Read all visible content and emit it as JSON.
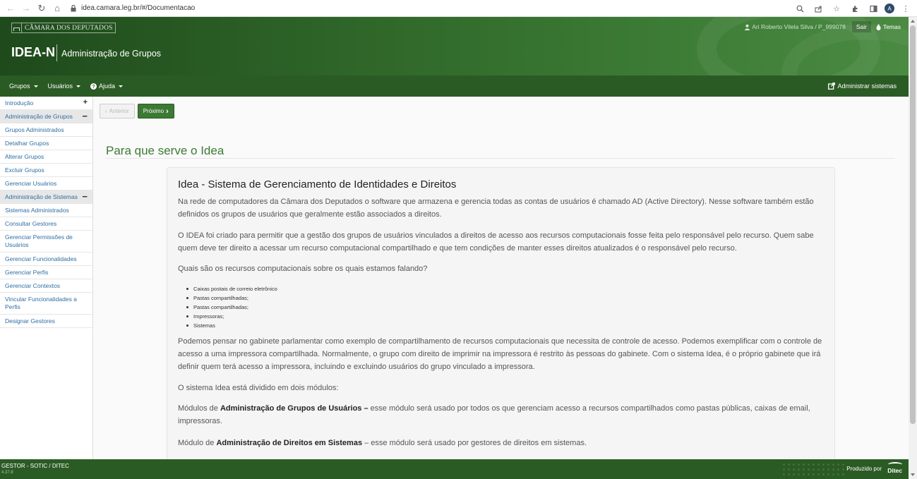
{
  "browser": {
    "url": "idea.camara.leg.br/#/Documentacao",
    "profile_initial": "A"
  },
  "header": {
    "logo_text": "CÂMARA DOS DEPUTADOS",
    "app_name": "IDEA-N",
    "app_subtitle": "Administração de Grupos",
    "user": "Ari Roberto Vilela Silva / P_999078",
    "logout": "Sair",
    "themes": "Temas"
  },
  "nav": {
    "groups": "Grupos",
    "users": "Usuários",
    "help": "Ajuda",
    "admin_systems": "Administrar sistemas"
  },
  "sidebar": {
    "items": [
      {
        "label": "Introdução",
        "toggle": "+"
      },
      {
        "label": "Administração de Grupos",
        "toggle": "−"
      },
      {
        "label": "Grupos Administrados"
      },
      {
        "label": "Detalhar Grupos"
      },
      {
        "label": "Alterar Grupos"
      },
      {
        "label": "Excluir Grupos"
      },
      {
        "label": "Gerenciar Usuários"
      },
      {
        "label": "Administração de Sistemas",
        "toggle": "−"
      },
      {
        "label": "Sistemas Administrados"
      },
      {
        "label": "Consultar Gestores"
      },
      {
        "label": "Gerenciar Permissões de Usuários"
      },
      {
        "label": "Gerenciar Funcionalidades"
      },
      {
        "label": "Gerenciar Perfis"
      },
      {
        "label": "Gerenciar Contextos"
      },
      {
        "label": "Vincular Funcionalidades a Perfis"
      },
      {
        "label": "Designar Gestores"
      }
    ]
  },
  "pager": {
    "previous": "Anterior",
    "next": "Próximo"
  },
  "page": {
    "title": "Para que serve o Idea",
    "card_title": "Idea - Sistema de Gerenciamento de Identidades e Direitos",
    "p1": "Na rede de computadores da Câmara dos Deputados o software que armazena e gerencia todas as contas de usuários é chamado AD (Active Directory). Nesse software também estão definidos os grupos de usuários que geralmente estão associados a direitos.",
    "p2": "O IDEA foi criado para permitir que a gestão dos grupos de usuários vinculados a direitos de acesso aos recursos computacionais fosse feita pelo responsável pelo recurso. Quem sabe quem deve ter direito a acessar um recurso computacional compartilhado e que tem condições de manter esses direitos atualizados é o responsável pelo recurso.",
    "p3": "Quais são os recursos computacionais sobre os quais estamos falando?",
    "bullets": [
      "Caixas postais de correio eletrônico",
      "Pastas compartilhadas;",
      "Pastas compartilhadas;",
      "Impressoras;",
      "Sistemas"
    ],
    "p4": "Podemos pensar no gabinete parlamentar como exemplo de compartilhamento de recursos computacionais que necessita de controle de acesso. Podemos exemplificar com o controle de acesso a uma impressora compartilhada. Normalmente, o grupo com direito de imprimir na impressora é restrito às pessoas do gabinete. Com o sistema Idea, é o próprio gabinete que irá definir quem terá acesso a impressora, incluindo e excluindo usuários do grupo vinculado a impressora.",
    "p5": "O sistema Idea está dividido em dois módulos:",
    "p6_prefix": "Módulos de ",
    "p6_bold": "Administração de Grupos de Usuários –",
    "p6_rest": " esse módulo será usado por todos os que gerenciam acesso a recursos compartilhados como pastas públicas, caixas de email, impressoras.",
    "p7_prefix": "Módulo de ",
    "p7_bold": "Administração de Direitos em Sistemas",
    "p7_rest": " – esse módulo será usado por gestores de direitos em sistemas."
  },
  "footer": {
    "org": "GESTOR - SOTIC / DITEC",
    "version": "4.37.8",
    "produced_by": "Produzido por",
    "ditec": "Ditec"
  }
}
